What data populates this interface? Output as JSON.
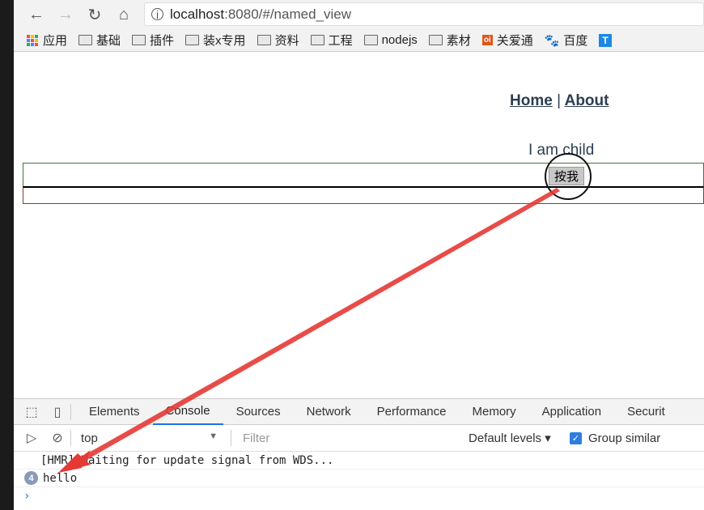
{
  "browser": {
    "url_host": "localhost",
    "url_rest": ":8080/#/named_view",
    "bookmarks": [
      {
        "label": "应用",
        "type": "apps"
      },
      {
        "label": "基础",
        "type": "folder"
      },
      {
        "label": "插件",
        "type": "folder"
      },
      {
        "label": "装x专用",
        "type": "folder"
      },
      {
        "label": "资料",
        "type": "folder"
      },
      {
        "label": "工程",
        "type": "folder"
      },
      {
        "label": "nodejs",
        "type": "folder"
      },
      {
        "label": "素材",
        "type": "folder"
      },
      {
        "label": "关爱通",
        "type": "site"
      },
      {
        "label": "百度",
        "type": "site"
      }
    ]
  },
  "page": {
    "nav_home": "Home",
    "nav_sep": "|",
    "nav_about": "About",
    "child_text": "I am child",
    "button_label": "按我"
  },
  "devtools": {
    "tabs": [
      "Elements",
      "Console",
      "Sources",
      "Network",
      "Performance",
      "Memory",
      "Application",
      "Securit"
    ],
    "active_tab": "Console",
    "context": "top",
    "filter_placeholder": "Filter",
    "levels": "Default levels ▾",
    "group_similar": "Group similar",
    "group_checked": true,
    "log_hmr": "[HMR] Waiting for update signal from WDS...",
    "log_count": "4",
    "log_hello": "hello",
    "prompt": "›"
  },
  "annotation_color": "#e53935"
}
